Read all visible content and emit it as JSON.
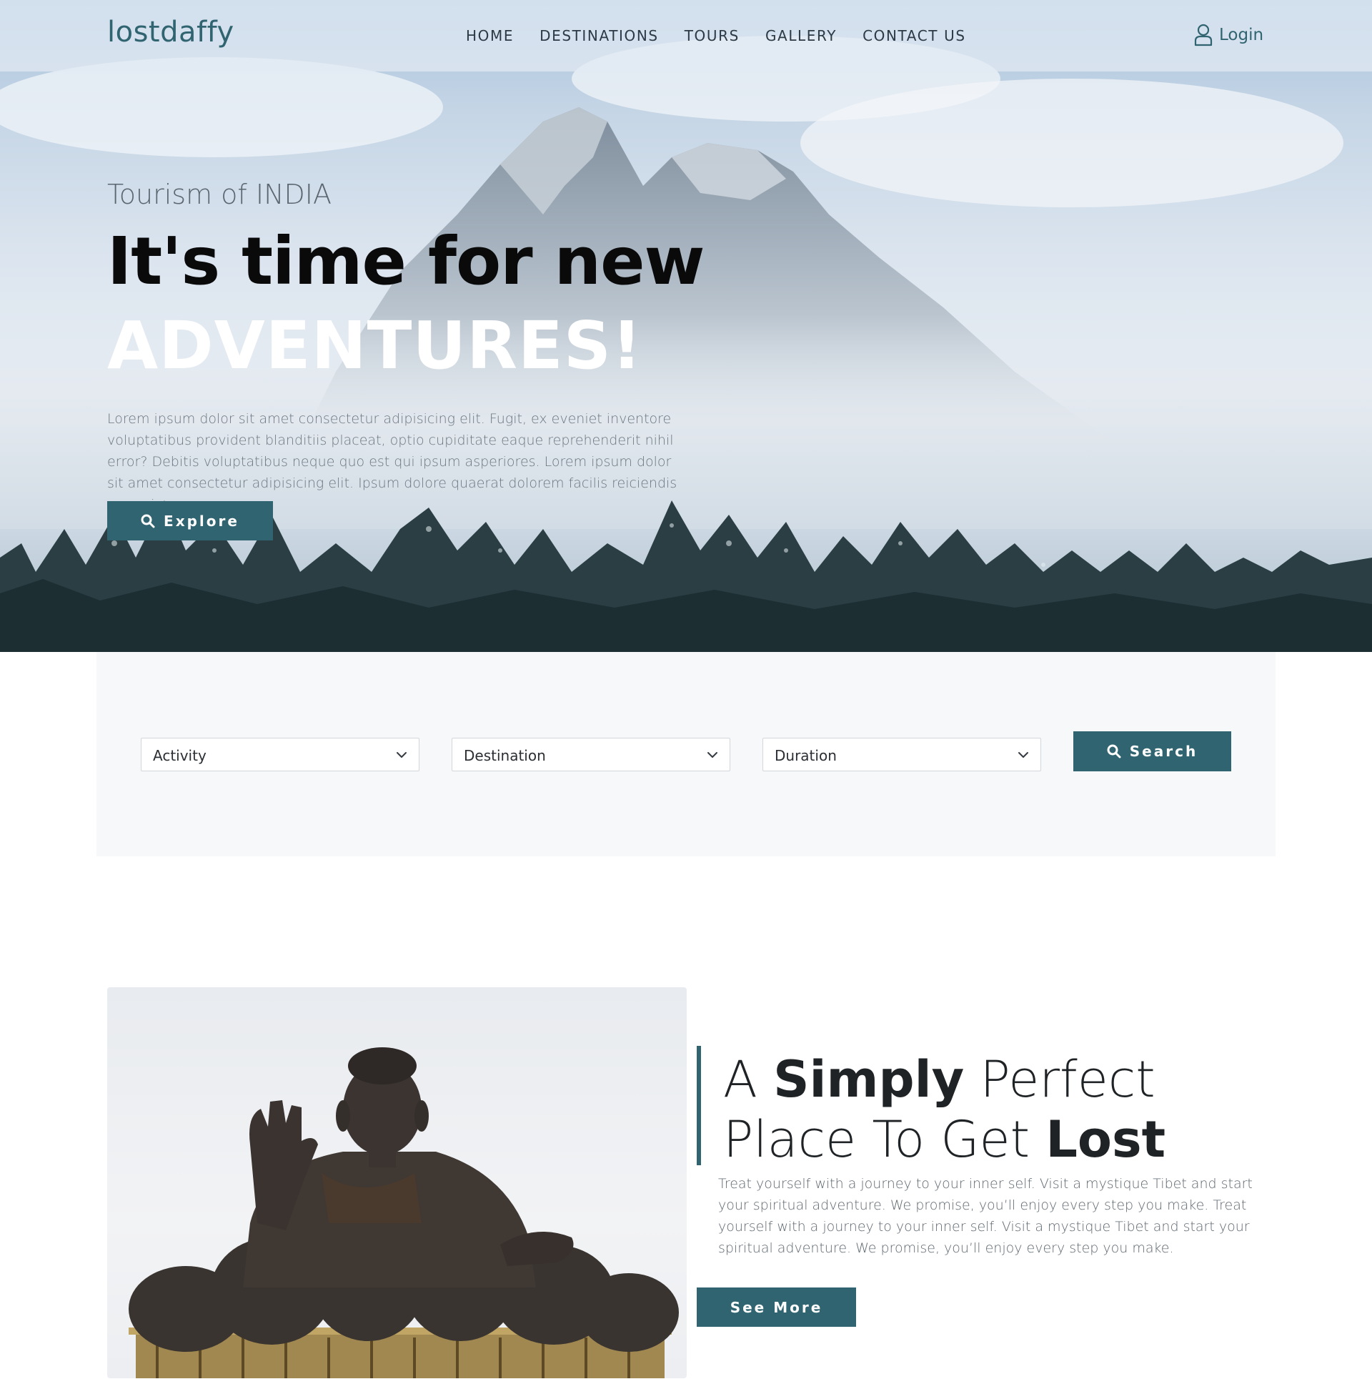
{
  "nav": {
    "logo": "lostdaffy",
    "links": [
      "HOME",
      "DESTINATIONS",
      "TOURS",
      "GALLERY",
      "CONTACT US"
    ],
    "login": "Login"
  },
  "hero": {
    "subtitle": "Tourism of INDIA",
    "title_line1": "It's time for new",
    "title_line2": "ADVENTURES!",
    "text": "Lorem ipsum dolor sit amet consectetur adipisicing elit. Fugit, ex eveniet inventore voluptatibus provident blanditiis placeat, optio cupiditate eaque reprehenderit nihil error? Debitis voluptatibus neque quo est qui ipsum asperiores. Lorem ipsum dolor sit amet consectetur adipisicing elit. Ipsum dolore quaerat dolorem facilis reiciendis a possimus",
    "button": "Explore"
  },
  "search": {
    "activity": "Activity",
    "destination": "Destination",
    "duration": "Duration",
    "button": "Search"
  },
  "about": {
    "title_a": "A ",
    "title_simply": "Simply",
    "title_mid": " Perfect Place To Get ",
    "title_lost": "Lost",
    "text": "Treat yourself with a journey to your inner self. Visit a mystique Tibet and start your spiritual adventure. We promise, you’ll enjoy every step you make. Treat yourself with a journey to your inner self. Visit a mystique Tibet and start your spiritual adventure. We promise, you’ll enjoy every step you make.",
    "button": "See More"
  },
  "colors": {
    "accent": "#2f6470",
    "panel": "#f7f8fa"
  },
  "icons": [
    "user-icon",
    "search-icon",
    "chevron-down-icon"
  ]
}
